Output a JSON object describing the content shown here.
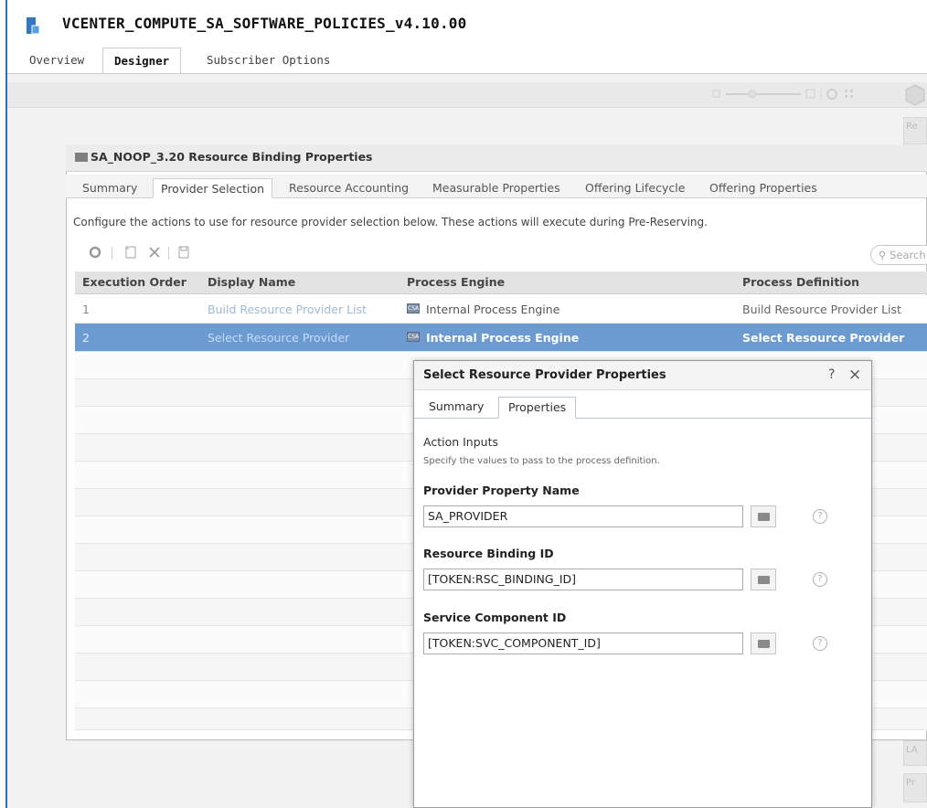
{
  "app": {
    "title": "VCENTER_COMPUTE_SA_SOFTWARE_POLICIES_v4.10.00",
    "tabs": [
      "Overview",
      "Designer",
      "Subscriber Options"
    ],
    "active_tab": "Designer"
  },
  "canvas": {
    "right_strip": {
      "label_top": "Re",
      "label_mid": "LA",
      "label_bottom": "Pr"
    }
  },
  "binding_window": {
    "title": "SA_NOOP_3.20 Resource Binding Properties",
    "tabs": [
      "Summary",
      "Provider Selection",
      "Resource Accounting",
      "Measurable Properties",
      "Offering Lifecycle",
      "Offering Properties"
    ],
    "active_tab": "Provider Selection",
    "description": "Configure the actions to use for resource provider selection below. These actions will execute during Pre-Reserving.",
    "search_placeholder": "Search",
    "table": {
      "columns": [
        "Execution Order",
        "Display Name",
        "Process Engine",
        "Process Definition"
      ],
      "rows": [
        {
          "order": "1",
          "name": "Build Resource Provider List",
          "engine": "Internal Process Engine",
          "definition": "Build Resource Provider List"
        },
        {
          "order": "2",
          "name": "Select Resource Provider",
          "engine": "Internal Process Engine",
          "definition": "Select Resource Provider"
        }
      ],
      "selected_row": 2
    }
  },
  "dialog": {
    "title": "Select Resource Provider Properties",
    "help": "?",
    "close": "×",
    "tabs": [
      "Summary",
      "Properties"
    ],
    "active_tab": "Properties",
    "section_title": "Action Inputs",
    "section_hint": "Specify the values to pass to the process definition.",
    "fields": [
      {
        "label": "Provider Property Name",
        "value": "SA_PROVIDER"
      },
      {
        "label": "Resource Binding ID",
        "value": "[TOKEN:RSC_BINDING_ID]"
      },
      {
        "label": "Service Component ID",
        "value": "[TOKEN:SVC_COMPONENT_ID]"
      }
    ]
  },
  "colors": {
    "selection": "#6c9bd2",
    "accent_rule": "#2f6fb0",
    "link_text": "#9fb9d3"
  },
  "icons": [
    "app-icon",
    "refresh-icon",
    "new-icon",
    "delete-icon",
    "save-icon",
    "search-icon",
    "engine-icon",
    "token-picker-icon",
    "help-circle-icon",
    "close-icon"
  ]
}
